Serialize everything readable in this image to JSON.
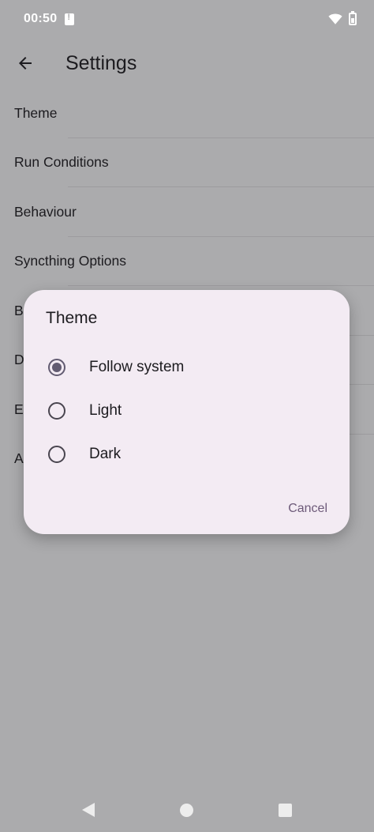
{
  "status_bar": {
    "time": "00:50"
  },
  "app_bar": {
    "title": "Settings"
  },
  "settings": {
    "items": [
      {
        "label": "Theme"
      },
      {
        "label": "Run Conditions"
      },
      {
        "label": "Behaviour"
      },
      {
        "label": "Syncthing Options"
      },
      {
        "label": "B"
      },
      {
        "label": "D"
      },
      {
        "label": "E"
      },
      {
        "label": "A"
      }
    ]
  },
  "dialog": {
    "title": "Theme",
    "options": [
      {
        "label": "Follow system",
        "selected": true
      },
      {
        "label": "Light",
        "selected": false
      },
      {
        "label": "Dark",
        "selected": false
      }
    ],
    "cancel_label": "Cancel"
  },
  "colors": {
    "scrim_background": "#ababad",
    "dialog_background": "#f3ebf3",
    "accent": "#625b71"
  }
}
